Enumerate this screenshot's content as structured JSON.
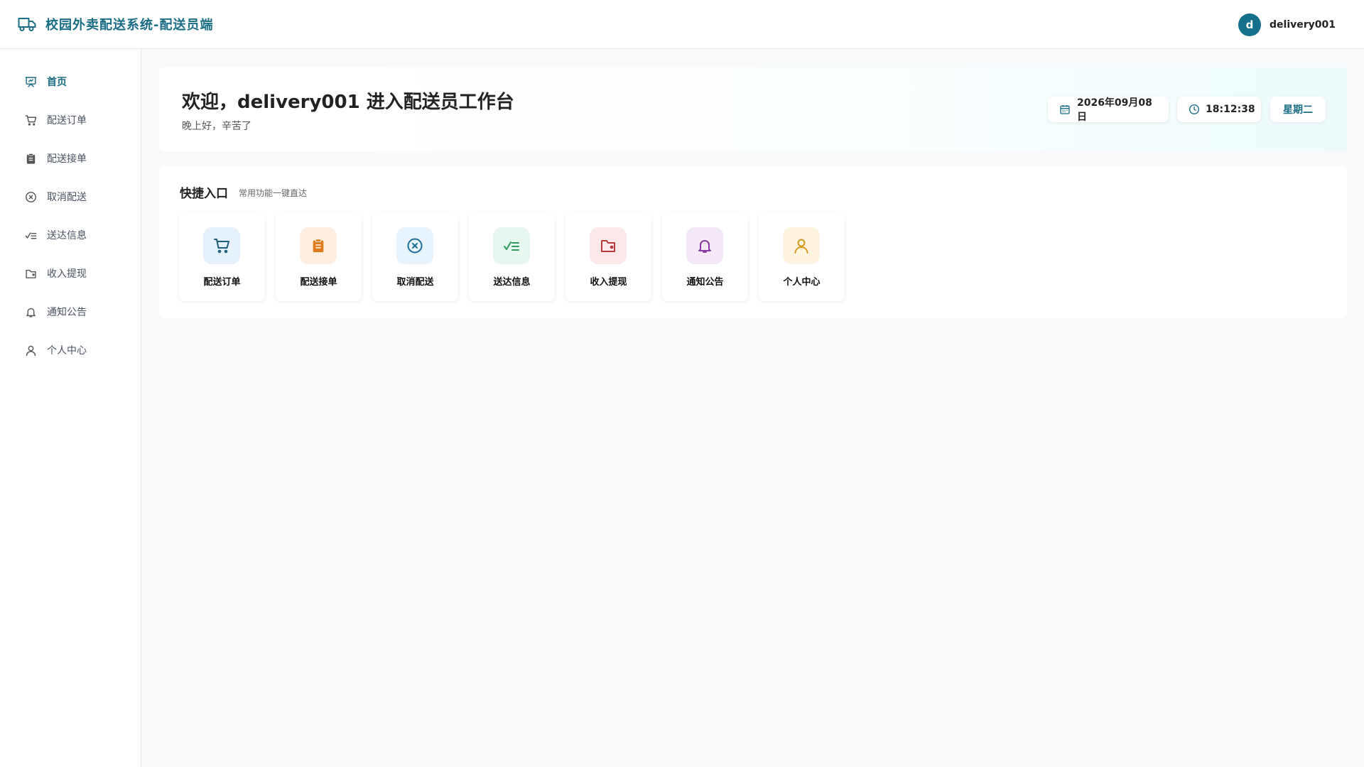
{
  "header": {
    "title": "校园外卖配送系统-配送员端",
    "brand_icon": "truck-icon",
    "avatar_letter": "d",
    "username": "delivery001"
  },
  "sidebar": {
    "items": [
      {
        "label": "首页",
        "icon": "presentation-icon",
        "active": true
      },
      {
        "label": "配送订单",
        "icon": "cart-icon"
      },
      {
        "label": "配送接单",
        "icon": "clipboard-icon"
      },
      {
        "label": "取消配送",
        "icon": "circle-x-icon"
      },
      {
        "label": "送达信息",
        "icon": "checklist-icon"
      },
      {
        "label": "收入提现",
        "icon": "wallet-icon"
      },
      {
        "label": "通知公告",
        "icon": "bell-icon"
      },
      {
        "label": "个人中心",
        "icon": "user-icon"
      }
    ]
  },
  "welcome": {
    "title": "欢迎，delivery001 进入配送员工作台",
    "subtitle": "晚上好，辛苦了",
    "date": "2026年09月08日",
    "time": "18:12:38",
    "weekday": "星期二"
  },
  "quick": {
    "title": "快捷入口",
    "subtitle": "常用功能一键直达",
    "cards": [
      {
        "label": "配送订单",
        "icon": "cart-icon",
        "bg": "#e6f1fb",
        "fg": "#1d5f7a"
      },
      {
        "label": "配送接单",
        "icon": "clipboard-icon",
        "bg": "#fdf0e3",
        "fg": "#e07a1c"
      },
      {
        "label": "取消配送",
        "icon": "circle-x-icon",
        "bg": "#e8f3fb",
        "fg": "#1a6d9a"
      },
      {
        "label": "送达信息",
        "icon": "checklist-icon",
        "bg": "#e7f6ee",
        "fg": "#2e9a5e"
      },
      {
        "label": "收入提现",
        "icon": "wallet-icon",
        "bg": "#fde9e9",
        "fg": "#b93a3a"
      },
      {
        "label": "通知公告",
        "icon": "bell-icon",
        "bg": "#f3e8f6",
        "fg": "#8a3aa0"
      },
      {
        "label": "个人中心",
        "icon": "user-icon",
        "bg": "#fdf5e1",
        "fg": "#d69a1c"
      }
    ]
  },
  "colors": {
    "accent": "#1a6d86",
    "page_bg": "#f8f9fb"
  }
}
